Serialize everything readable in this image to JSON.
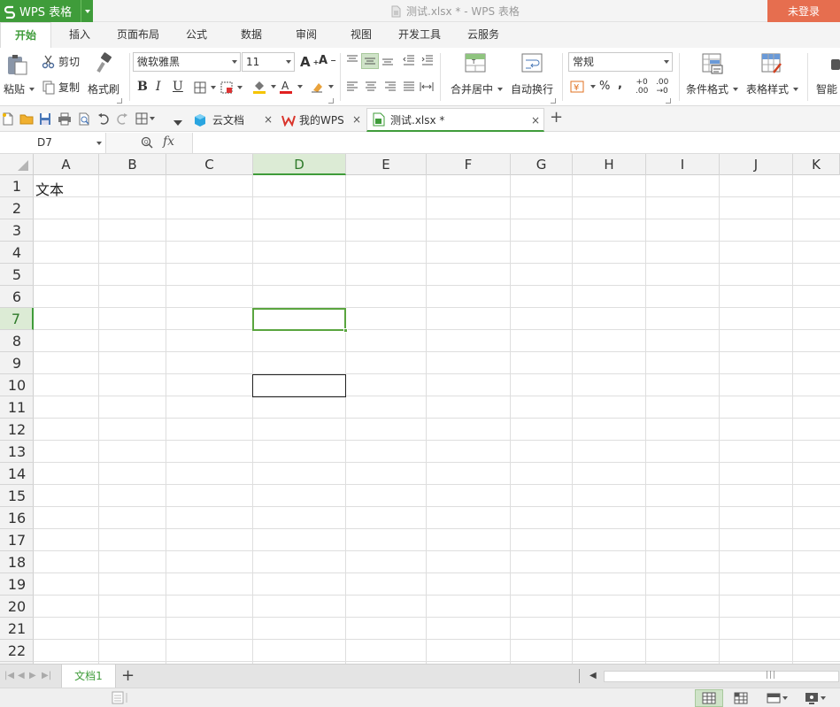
{
  "app": {
    "name": "WPS 表格",
    "window_title": "测试.xlsx * - WPS 表格",
    "login_label": "未登录"
  },
  "menu": {
    "tabs": [
      "开始",
      "插入",
      "页面布局",
      "公式",
      "数据",
      "审阅",
      "视图",
      "开发工具",
      "云服务"
    ],
    "active": "开始"
  },
  "ribbon": {
    "cut": "剪切",
    "paste": "粘贴",
    "copy": "复制",
    "format_painter": "格式刷",
    "font_name": "微软雅黑",
    "font_size": "11",
    "merge_center": "合并居中",
    "wrap_text": "自动换行",
    "number_format": "常规",
    "conditional_format": "条件格式",
    "table_style": "表格样式",
    "smart": "智能"
  },
  "doc_tabs": {
    "cloud": "云文档",
    "mywps": "我的WPS",
    "current": "测试.xlsx *"
  },
  "formula_bar": {
    "cell_ref": "D7",
    "fx_label": "fx",
    "content": ""
  },
  "grid": {
    "columns": [
      "A",
      "B",
      "C",
      "D",
      "E",
      "F",
      "G",
      "H",
      "I",
      "J",
      "K"
    ],
    "rows": [
      "1",
      "2",
      "3",
      "4",
      "5",
      "6",
      "7",
      "8",
      "9",
      "10",
      "11",
      "12",
      "13",
      "14",
      "15",
      "16",
      "17",
      "18",
      "19",
      "20",
      "21",
      "22"
    ],
    "selected_column": "D",
    "selected_row": "7",
    "cells": {
      "A1": "文本"
    }
  },
  "sheets": {
    "tabs": [
      "文档1"
    ],
    "add_label": "+"
  },
  "colors": {
    "accent": "#3f9c3a",
    "login_bg": "#e66e4f"
  }
}
